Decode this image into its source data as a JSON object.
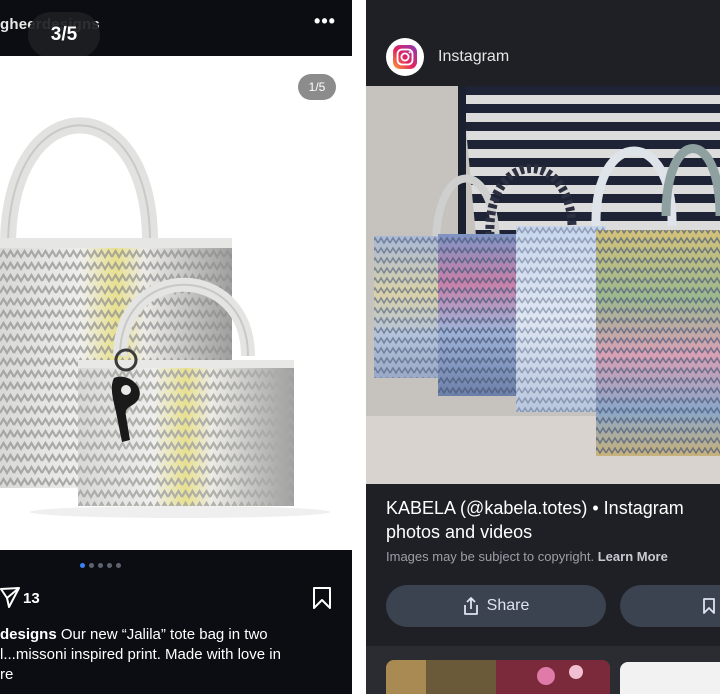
{
  "left_post": {
    "username": "gheerdesigns",
    "carousel_position": "3/5",
    "more_label": "•••",
    "image_counter": "1/5",
    "dots_total": 5,
    "dots_active_index": 0,
    "share_count": "13",
    "caption_user": "designs",
    "caption_text": " Our new “Jalila” tote bag in two",
    "caption_line2": "l...missoni inspired print. Made with love in",
    "caption_line3": "re",
    "accent_color": "#3b82f6"
  },
  "right_result": {
    "source": "Instagram",
    "title": "KABELA (@kabela.totes) • Instagram photos and videos",
    "copyright_text": "Images may be subject to copyright.",
    "learn_more": "Learn More",
    "share_label": "Share",
    "share_icon": "share-upload-icon",
    "save_icon": "bookmark-icon"
  }
}
